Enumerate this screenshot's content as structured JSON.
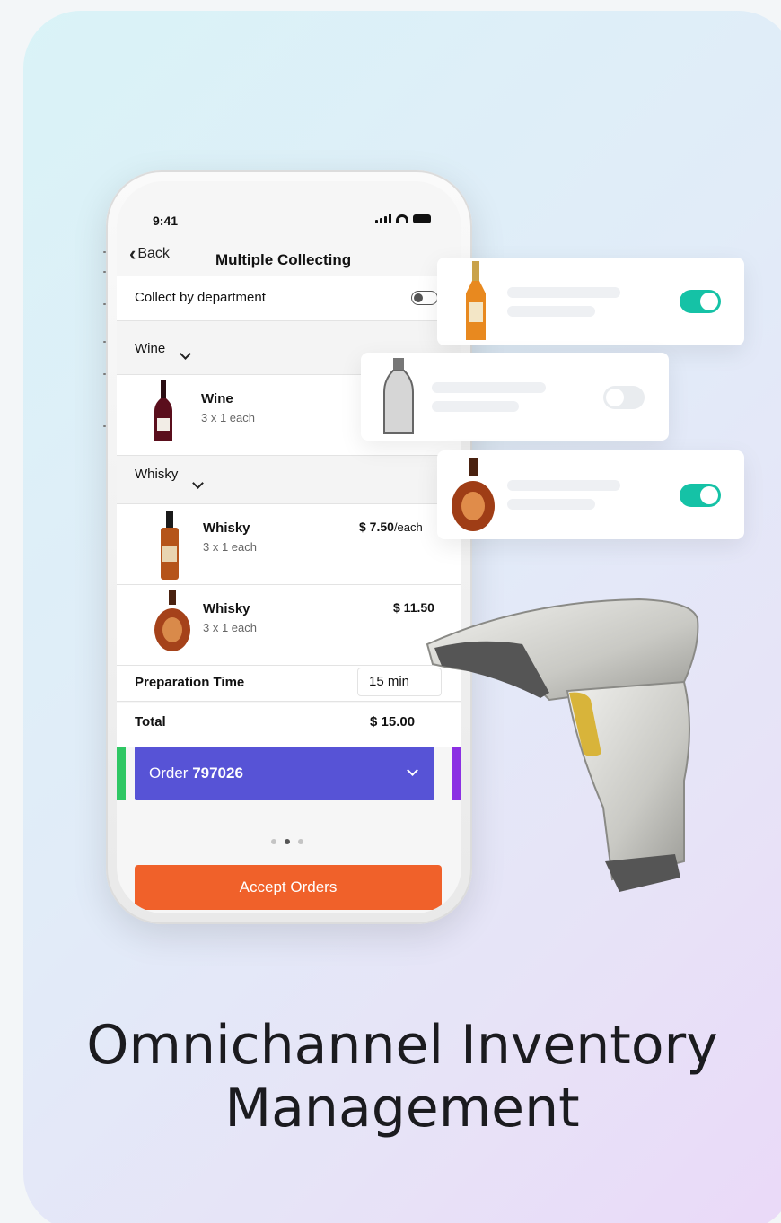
{
  "phone": {
    "status_time": "9:41",
    "back_label": "Back",
    "title": "Multiple Collecting",
    "collect_by_department": "Collect by department",
    "sections": [
      {
        "name": "Wine",
        "items": [
          {
            "name": "Wine",
            "qty": "3 x 1 each",
            "price": ""
          }
        ]
      },
      {
        "name": "Whisky",
        "items": [
          {
            "name": "Whisky",
            "qty": "3 x 1 each",
            "price": "$ 7.50",
            "price_unit": "/each"
          },
          {
            "name": "Whisky",
            "qty": "3 x 1 each",
            "price": "$ 11.50",
            "price_unit": ""
          }
        ]
      }
    ],
    "prep_label": "Preparation Time",
    "prep_value": "15 min",
    "total_label": "Total",
    "total_value": "$ 15.00",
    "order_prefix": "Order ",
    "order_number": "797026",
    "page_dots": {
      "count": 3,
      "active_index": 1
    },
    "accept_label": "Accept Orders"
  },
  "product_cards": [
    {
      "product": "whisky-bottle",
      "toggle": "on"
    },
    {
      "product": "blank-bottle",
      "toggle": "off"
    },
    {
      "product": "cognac-bottle",
      "toggle": "on"
    }
  ],
  "headline": {
    "line1": "Omnichannel Inventory",
    "line2": "Management"
  },
  "colors": {
    "accent_purple": "#5753d6",
    "accept_orange": "#f0612a",
    "toggle_teal": "#15c2a6"
  }
}
